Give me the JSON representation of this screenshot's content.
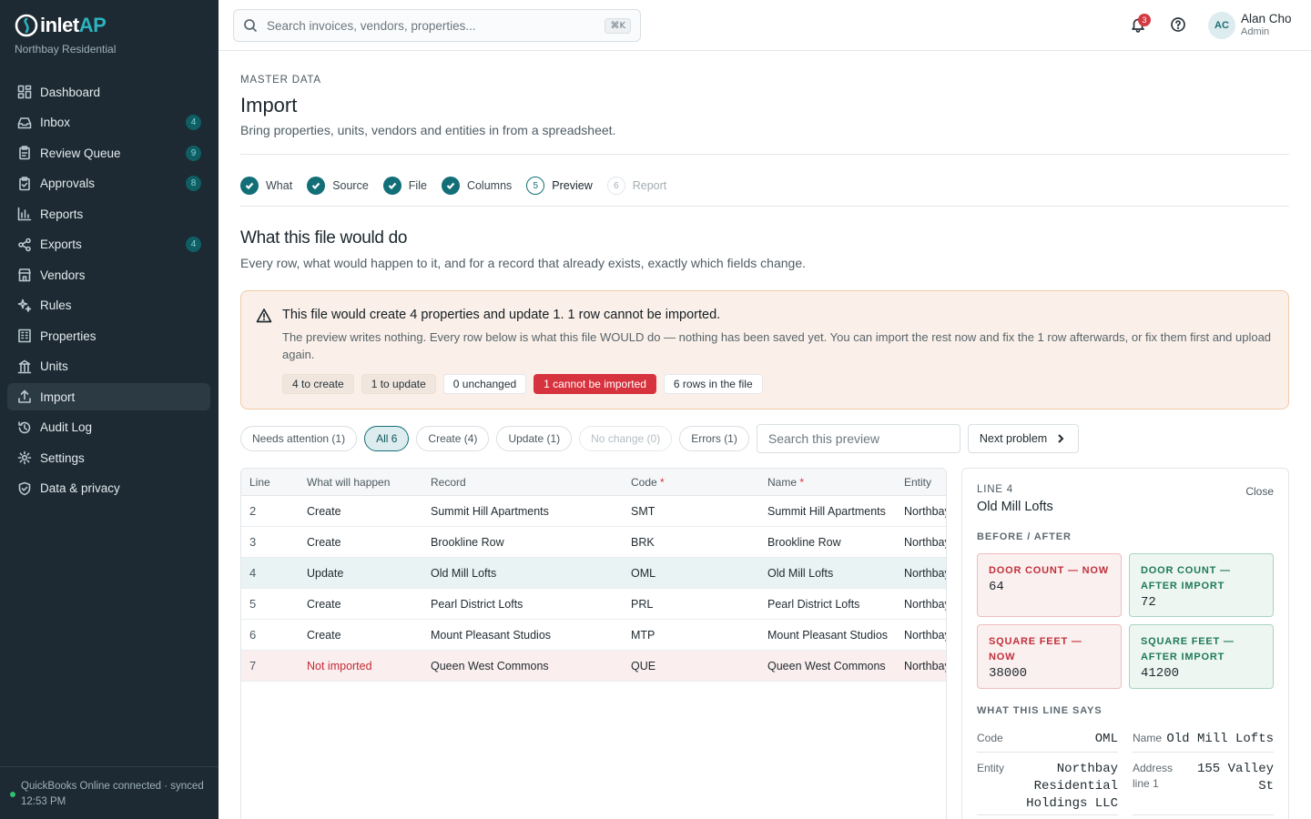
{
  "brand": {
    "name_part1": "inlet",
    "name_part2": "AP",
    "org": "Northbay Residential"
  },
  "sidebar": {
    "items": [
      {
        "label": "Dashboard",
        "icon": "dashboard-icon",
        "badge": ""
      },
      {
        "label": "Inbox",
        "icon": "inbox-icon",
        "badge": "4"
      },
      {
        "label": "Review Queue",
        "icon": "clipboard-icon",
        "badge": "9"
      },
      {
        "label": "Approvals",
        "icon": "clipboard-check-icon",
        "badge": "8"
      },
      {
        "label": "Reports",
        "icon": "bar-chart-icon",
        "badge": ""
      },
      {
        "label": "Exports",
        "icon": "share-icon",
        "badge": "4"
      },
      {
        "label": "Vendors",
        "icon": "store-icon",
        "badge": ""
      },
      {
        "label": "Rules",
        "icon": "sparkle-icon",
        "badge": ""
      },
      {
        "label": "Properties",
        "icon": "building-icon",
        "badge": ""
      },
      {
        "label": "Units",
        "icon": "columns-icon",
        "badge": ""
      },
      {
        "label": "Import",
        "icon": "upload-icon",
        "badge": "",
        "active": true
      },
      {
        "label": "Audit Log",
        "icon": "history-icon",
        "badge": ""
      },
      {
        "label": "Settings",
        "icon": "gear-icon",
        "badge": ""
      },
      {
        "label": "Data & privacy",
        "icon": "shield-icon",
        "badge": ""
      }
    ],
    "footer": "QuickBooks Online connected · synced 12:53 PM"
  },
  "topbar": {
    "search_placeholder": "Search invoices, vendors, properties...",
    "shortcut": "⌘K",
    "notifications": "3",
    "avatar_initials": "AC",
    "user_name": "Alan Cho",
    "user_role": "Admin"
  },
  "page": {
    "eyebrow": "MASTER DATA",
    "title": "Import",
    "subtitle": "Bring properties, units, vendors and entities in from a spreadsheet."
  },
  "steps": [
    {
      "num": "1",
      "label": "What",
      "state": "done"
    },
    {
      "num": "2",
      "label": "Source",
      "state": "done"
    },
    {
      "num": "3",
      "label": "File",
      "state": "done"
    },
    {
      "num": "4",
      "label": "Columns",
      "state": "done"
    },
    {
      "num": "5",
      "label": "Preview",
      "state": "current"
    },
    {
      "num": "6",
      "label": "Report",
      "state": "todo"
    }
  ],
  "section": {
    "title": "What this file would do",
    "subtitle": "Every row, what would happen to it, and for a record that already exists, exactly which fields change."
  },
  "alert": {
    "title": "This file would create 4 properties and update 1. 1 row cannot be imported.",
    "text": "The preview writes nothing. Every row below is what this file WOULD do — nothing has been saved yet. You can import the rest now and fix the 1 row afterwards, or fix them first and upload again.",
    "chips": [
      "4 to create",
      "1 to update",
      "0 unchanged",
      "1 cannot be imported",
      "6 rows in the file"
    ]
  },
  "filters": {
    "items": [
      "Needs attention (1)",
      "All 6",
      "Create (4)",
      "Update (1)",
      "No change (0)",
      "Errors (1)"
    ],
    "search_placeholder": "Search this preview",
    "next_label": "Next problem"
  },
  "table": {
    "headers": [
      "Line",
      "What will happen",
      "Record",
      "Code",
      "Name",
      "Entity"
    ],
    "rows": [
      {
        "line": "2",
        "action": "Create",
        "record": "Summit Hill Apartments",
        "code": "SMT",
        "name": "Summit Hill Apartments",
        "entity": "Northbay"
      },
      {
        "line": "3",
        "action": "Create",
        "record": "Brookline Row",
        "code": "BRK",
        "name": "Brookline Row",
        "entity": "Northbay"
      },
      {
        "line": "4",
        "action": "Update",
        "record": "Old Mill Lofts",
        "code": "OML",
        "name": "Old Mill Lofts",
        "entity": "Northbay"
      },
      {
        "line": "5",
        "action": "Create",
        "record": "Pearl District Lofts",
        "code": "PRL",
        "name": "Pearl District Lofts",
        "entity": "Northbay"
      },
      {
        "line": "6",
        "action": "Create",
        "record": "Mount Pleasant Studios",
        "code": "MTP",
        "name": "Mount Pleasant Studios",
        "entity": "Northbay"
      },
      {
        "line": "7",
        "action": "Not imported",
        "record": "Queen West Commons",
        "code": "QUE",
        "name": "Queen West Commons",
        "entity": "Northbay"
      }
    ]
  },
  "detail": {
    "line": "LINE 4",
    "close": "Close",
    "title": "Old Mill Lofts",
    "before_after_label": "BEFORE / AFTER",
    "door_before_key": "DOOR COUNT — NOW",
    "door_before_val": "64",
    "door_after_key": "DOOR COUNT — AFTER IMPORT",
    "door_after_val": "72",
    "sqft_before_key": "SQUARE FEET — NOW",
    "sqft_before_val": "38000",
    "sqft_after_key": "SQUARE FEET — AFTER IMPORT",
    "sqft_after_val": "41200",
    "says_label": "WHAT THIS LINE SAYS",
    "code_key": "Code",
    "code_val": "OML",
    "name_key": "Name",
    "name_val": "Old Mill Lofts",
    "entity_key": "Entity",
    "entity_val": "Northbay Residential Holdings LLC",
    "address_key": "Address line 1",
    "address_val": "155 Valley St"
  }
}
